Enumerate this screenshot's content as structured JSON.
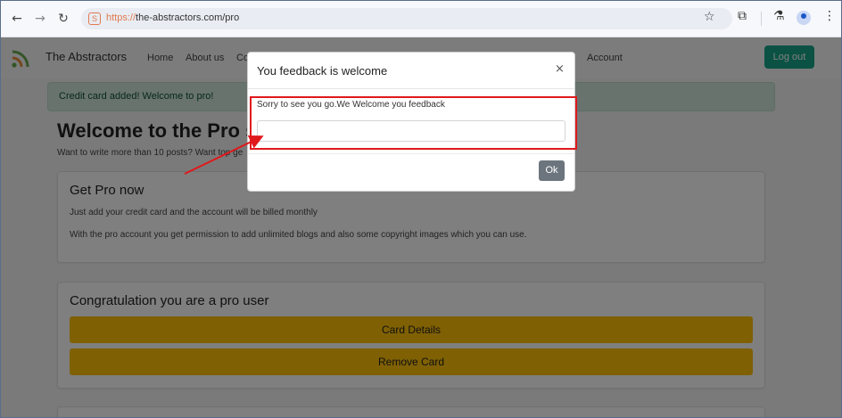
{
  "browser": {
    "url_scheme": "https://",
    "url_rest": "the-abstractors.com/pro",
    "site_icon": "S",
    "back_icon": "←",
    "forward_icon": "→",
    "reload_icon": "↻",
    "star_icon": "☆",
    "extensions_icon": "⧉",
    "lab_icon": "⚗",
    "menu_icon": "⋮"
  },
  "navbar": {
    "brand": "The Abstractors",
    "links": [
      "Home",
      "About us",
      "Co",
      "Account"
    ],
    "logout_label": "Log out"
  },
  "alert": {
    "text": "Credit card added! Welcome to pro!"
  },
  "main": {
    "title": "Welcome to the Pro se",
    "subtitle": "Want to write more than 10 posts? Want top ge"
  },
  "get_pro_card": {
    "title": "Get Pro now",
    "line1": "Just add your credit card and the account will be billed monthly",
    "line2": "With the pro account you get permission to add unlimited blogs and also some copyright images which you can use."
  },
  "pro_user_card": {
    "title": "Congratulation you are a pro user",
    "card_details_label": "Card Details",
    "remove_card_label": "Remove Card"
  },
  "modal": {
    "title": "You feedback is welcome",
    "close_icon": "×",
    "label": "Sorry to see you go.We Welcome you feedback",
    "input_value": "",
    "ok_label": "Ok"
  },
  "colors": {
    "accent_green": "#17a589",
    "warning": "#ffc107",
    "annotation_red": "#e0191c"
  }
}
